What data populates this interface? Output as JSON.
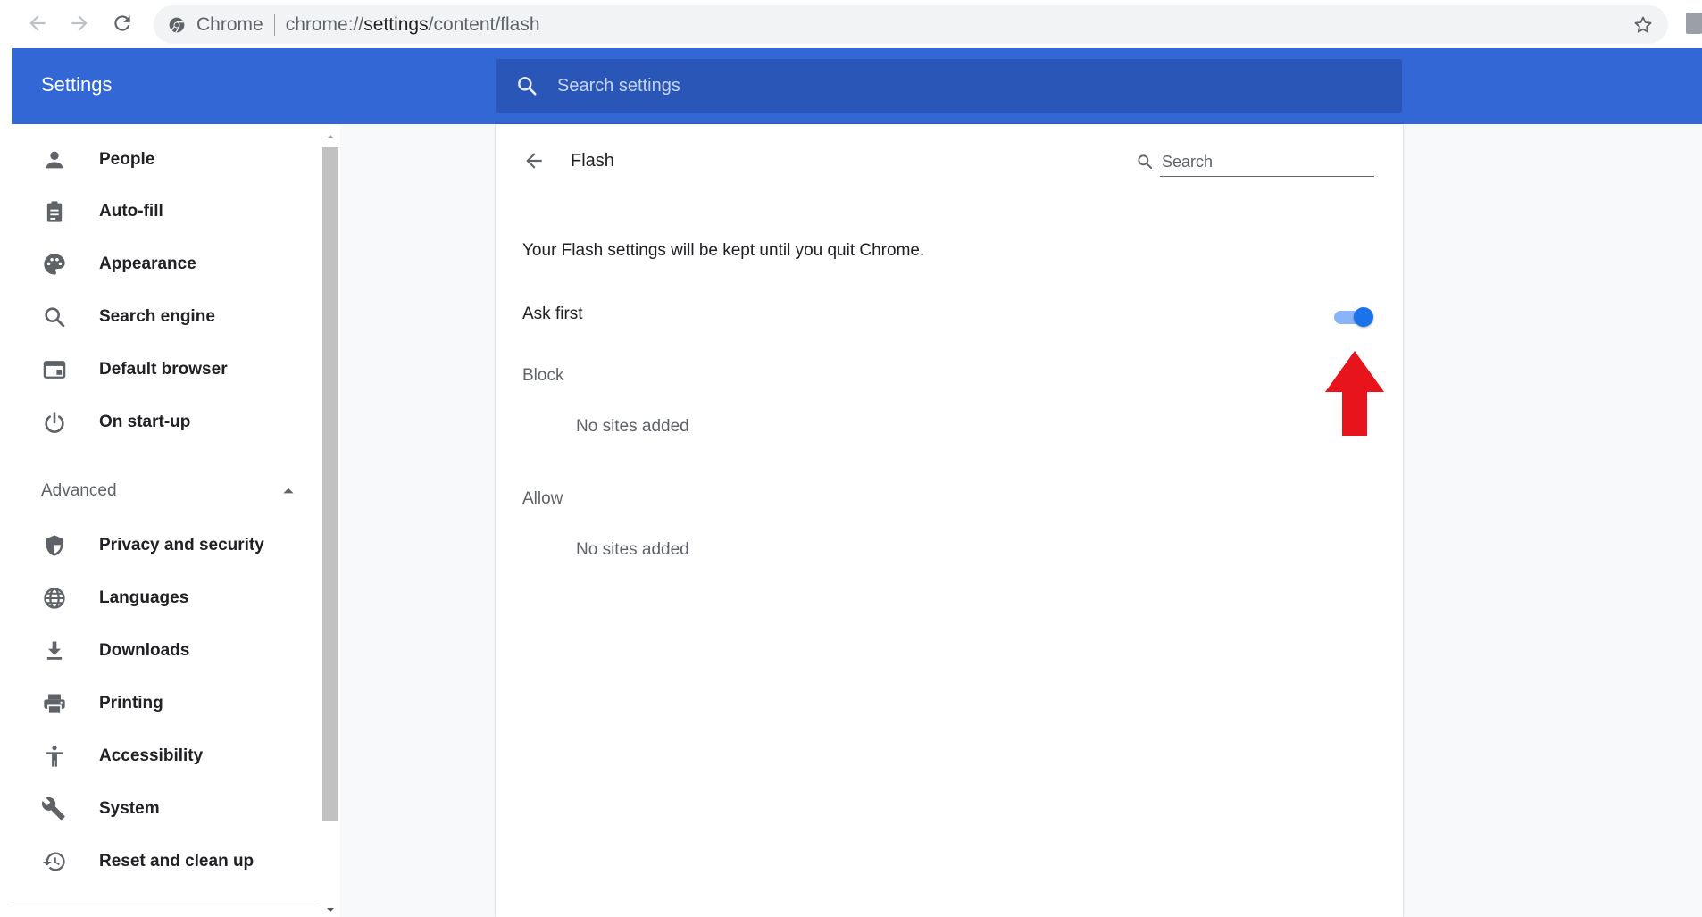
{
  "browser": {
    "origin_label": "Chrome",
    "url_scheme": "chrome://",
    "url_host": "settings",
    "url_path": "/content/flash"
  },
  "header": {
    "title": "Settings",
    "search_placeholder": "Search settings",
    "color": "#3367d6"
  },
  "sidebar": {
    "items": [
      {
        "label": "People",
        "icon": "person-icon"
      },
      {
        "label": "Auto-fill",
        "icon": "clipboard-icon"
      },
      {
        "label": "Appearance",
        "icon": "palette-icon"
      },
      {
        "label": "Search engine",
        "icon": "search-icon"
      },
      {
        "label": "Default browser",
        "icon": "browser-window-icon"
      },
      {
        "label": "On start-up",
        "icon": "power-icon"
      }
    ],
    "advanced_label": "Advanced",
    "advanced_items": [
      {
        "label": "Privacy and security",
        "icon": "shield-icon"
      },
      {
        "label": "Languages",
        "icon": "globe-icon"
      },
      {
        "label": "Downloads",
        "icon": "download-icon"
      },
      {
        "label": "Printing",
        "icon": "printer-icon"
      },
      {
        "label": "Accessibility",
        "icon": "accessibility-icon"
      },
      {
        "label": "System",
        "icon": "wrench-icon"
      },
      {
        "label": "Reset and clean up",
        "icon": "history-icon"
      }
    ]
  },
  "page": {
    "title": "Flash",
    "search_placeholder": "Search",
    "info": "Your Flash settings will be kept until you quit Chrome.",
    "ask_first": {
      "label": "Ask first",
      "enabled": true
    },
    "block": {
      "label": "Block",
      "empty": "No sites added"
    },
    "allow": {
      "label": "Allow",
      "empty": "No sites added"
    }
  },
  "annotation": {
    "arrow_color": "#e8141c"
  }
}
